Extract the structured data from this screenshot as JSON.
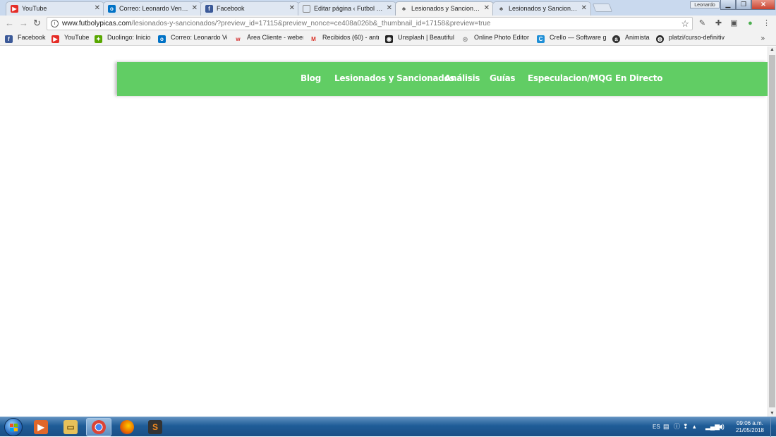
{
  "browser": {
    "tabs": [
      {
        "label": "YouTube",
        "icon": "youtube-icon",
        "color": "#e52d27"
      },
      {
        "label": "Correo: Leonardo Venez",
        "icon": "outlook-icon",
        "color": "#0072c6"
      },
      {
        "label": "Facebook",
        "icon": "facebook-icon",
        "color": "#3b5998"
      },
      {
        "label": "Editar página ‹ Futbol Y P",
        "icon": "document-icon",
        "color": "#8a8a8a"
      },
      {
        "label": "Lesionados y Sancionado",
        "icon": "site-icon",
        "color": "#555555",
        "active": true
      },
      {
        "label": "Lesionados y Sancionado",
        "icon": "site-icon",
        "color": "#555555"
      }
    ],
    "user_badge": "Leonardo",
    "url_host": "www.futbolypicas.com",
    "url_path": "/lesionados-y-sancionados/?preview_id=17115&preview_nonce=ce408a026b&_thumbnail_id=17158&preview=true",
    "bookmarks": [
      {
        "label": "Facebook",
        "icon": "facebook-icon",
        "color": "#3b5998",
        "glyph": "f"
      },
      {
        "label": "YouTube",
        "icon": "youtube-icon",
        "color": "#e52d27",
        "glyph": "▶"
      },
      {
        "label": "Duolingo: Inicio",
        "icon": "duolingo-icon",
        "color": "#58a700",
        "glyph": "✦"
      },
      {
        "label": "Correo: Leonardo Ve",
        "icon": "outlook-icon",
        "color": "#0072c6",
        "glyph": "o"
      },
      {
        "label": "Área Cliente - weber",
        "icon": "webempresa-icon",
        "color": "#d32f2f",
        "glyph": "w"
      },
      {
        "label": "Recibidos (60) - antr",
        "icon": "gmail-icon",
        "color": "#d93025",
        "glyph": "M"
      },
      {
        "label": "Unsplash | Beautiful",
        "icon": "camera-icon",
        "color": "#222222",
        "glyph": "◉"
      },
      {
        "label": "Online Photo Editor",
        "icon": "photo-editor-icon",
        "color": "#9e9e9e",
        "glyph": "◎"
      },
      {
        "label": "Crello — Software g",
        "icon": "crello-icon",
        "color": "#1f8fd6",
        "glyph": "C"
      },
      {
        "label": "Animista",
        "icon": "animista-icon",
        "color": "#333333",
        "glyph": "a"
      },
      {
        "label": "platzi/curso-definitiv",
        "icon": "github-icon",
        "color": "#222222",
        "glyph": "◍"
      }
    ],
    "bookmarks_more": "»"
  },
  "site": {
    "nav_color": "#61cd64",
    "nav": [
      {
        "label": "Blog"
      },
      {
        "label": "Lesionados y Sancionados"
      },
      {
        "label": "Análisis"
      },
      {
        "label": "Guías"
      },
      {
        "label": "Especulacion/MQG"
      },
      {
        "label": "En Directo"
      }
    ]
  },
  "taskbar": {
    "apps": [
      {
        "icon": "media-player-icon",
        "color": "#e0672a",
        "glyph": "▶"
      },
      {
        "icon": "file-explorer-icon",
        "color": "#e8c15a",
        "glyph": "▭"
      },
      {
        "icon": "chrome-icon",
        "color": "#4285f4",
        "glyph": "◉",
        "active": true
      },
      {
        "icon": "firefox-icon",
        "color": "#e66000",
        "glyph": "◐"
      },
      {
        "icon": "sublime-text-icon",
        "color": "#f58c1f",
        "glyph": "S"
      }
    ],
    "language": "ES",
    "time": "09:06 a.m.",
    "date": "21/05/2018"
  }
}
